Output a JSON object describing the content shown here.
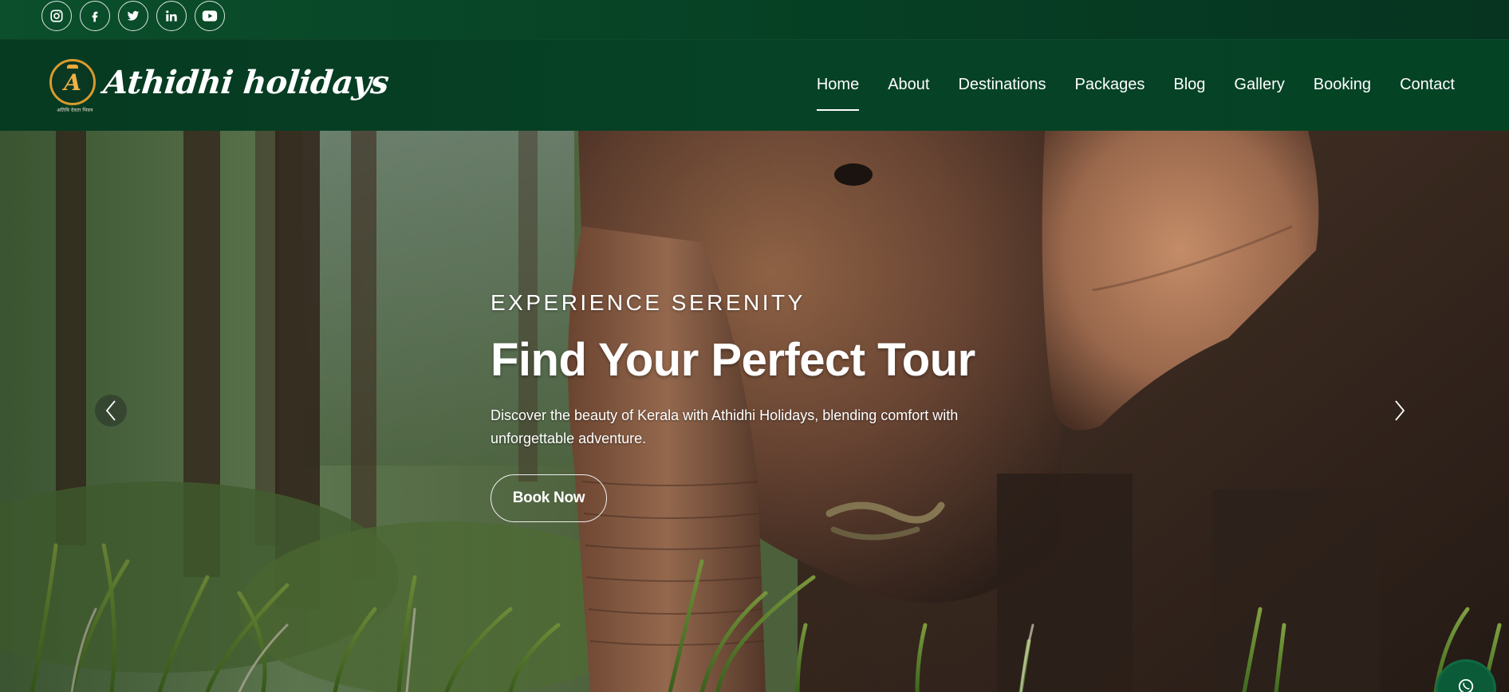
{
  "social": {
    "icons": [
      "instagram-icon",
      "facebook-icon",
      "twitter-icon",
      "linkedin-icon",
      "youtube-icon"
    ]
  },
  "brand": {
    "name": "Athidhi holidays",
    "emblem_letter": "A",
    "tagline": "अतिथि देवता भिवन"
  },
  "nav": {
    "items": [
      "Home",
      "About",
      "Destinations",
      "Packages",
      "Blog",
      "Gallery",
      "Booking",
      "Contact"
    ],
    "active": "Home"
  },
  "hero": {
    "eyebrow": "EXPERIENCE SERENITY",
    "title": "Find Your Perfect Tour",
    "description": "Discover the beauty of Kerala with Athidhi Holidays, blending comfort with unforgettable adventure.",
    "cta": "Book Now"
  },
  "colors": {
    "header_green": "#064226",
    "topbar_green": "#0b4f2c",
    "accent_gold": "#d89b2e",
    "whatsapp_green": "#0b5b38"
  }
}
